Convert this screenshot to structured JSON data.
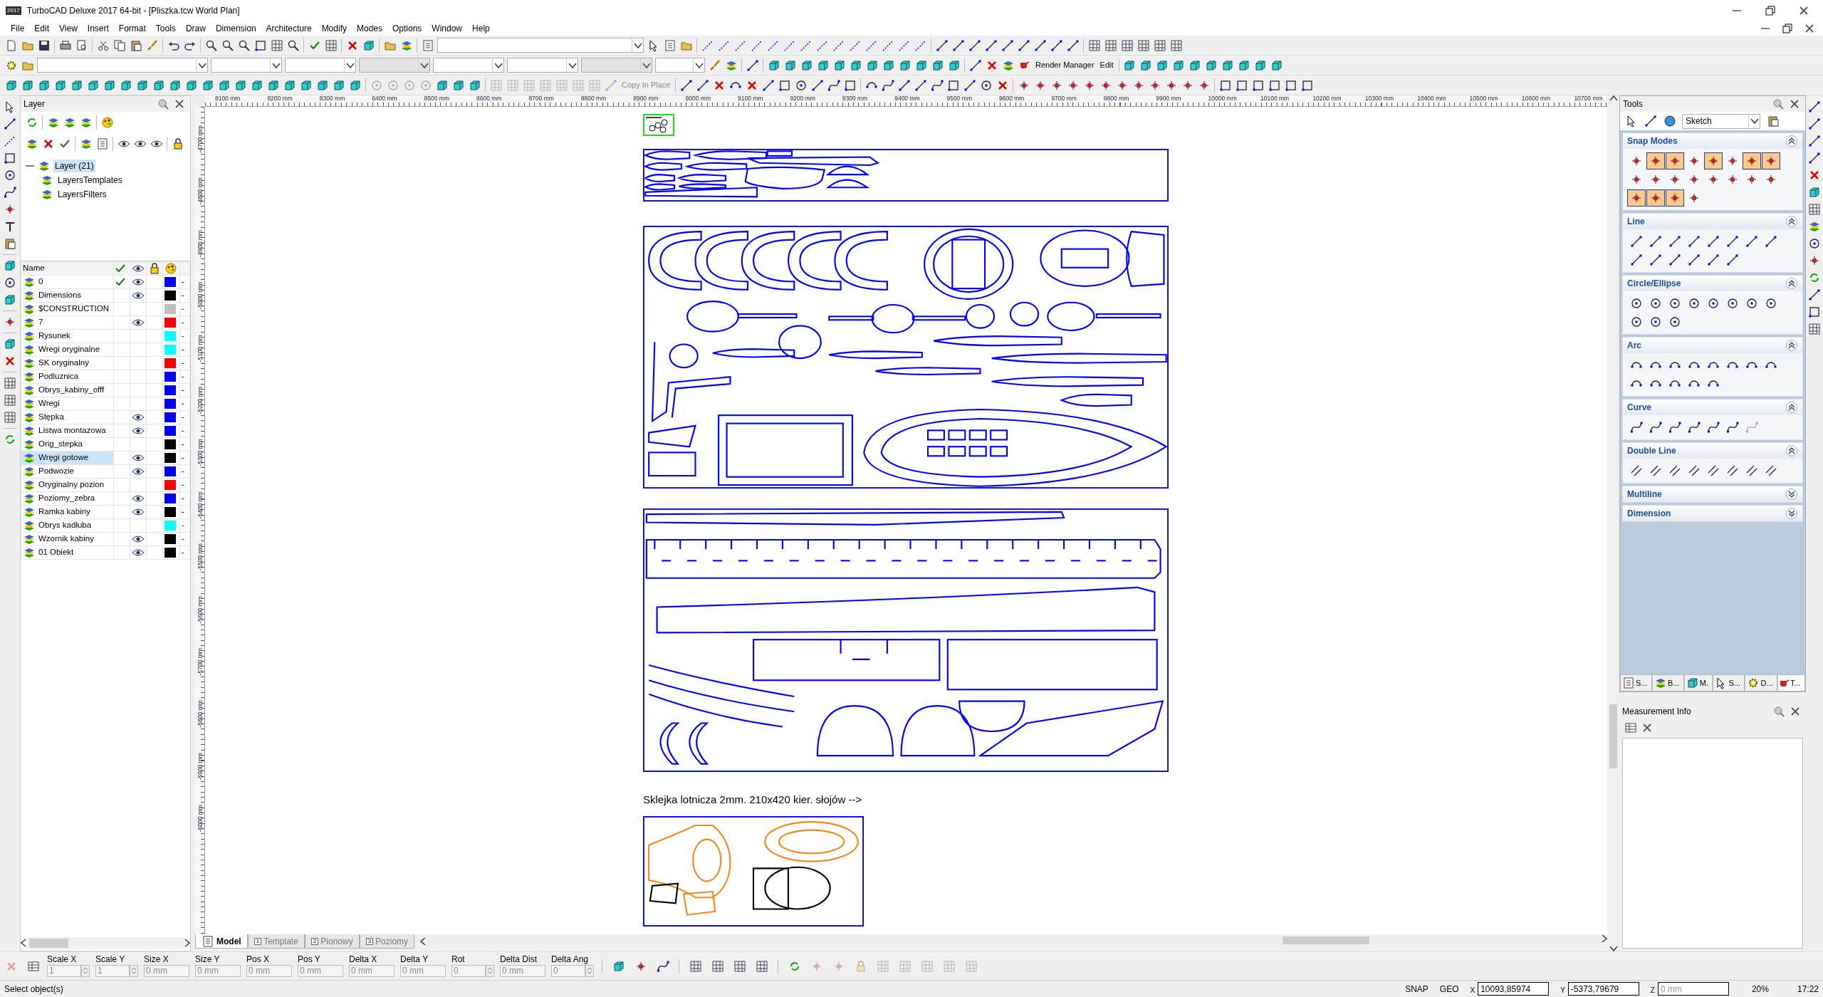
{
  "window": {
    "logo": "2017",
    "title": "TurboCAD Deluxe 2017 64-bit - [Pliszka.tcw World Plan]"
  },
  "menu": [
    "File",
    "Edit",
    "View",
    "Insert",
    "Format",
    "Tools",
    "Draw",
    "Dimension",
    "Architecture",
    "Modify",
    "Modes",
    "Options",
    "Window",
    "Help"
  ],
  "toolbars": {
    "render_manager": {
      "label": "Render Manager",
      "disabled": false
    },
    "edit": {
      "label": "Edit",
      "disabled": false
    },
    "copy_in_place": {
      "label": "Copy In Place",
      "disabled": true
    }
  },
  "rulers": {
    "top": [
      "8100 mm",
      "8200 mm",
      "8300 mm",
      "8400 mm",
      "8500 mm",
      "8600 mm",
      "8700 mm",
      "8800 mm",
      "8900 mm",
      "9000 mm",
      "9100 mm",
      "9200 mm",
      "9300 mm",
      "9400 mm",
      "9500 mm",
      "9600 mm",
      "9700 mm",
      "9800 mm",
      "9900 mm",
      "10000 mm",
      "10100 mm",
      "10200 mm",
      "10300 mm",
      "10400 mm",
      "10500 mm",
      "10600 mm",
      "10700 mm"
    ],
    "left": [
      "-4700 mm",
      "-4800 mm",
      "-4900 mm",
      "-5000 mm",
      "-5100 mm",
      "-5200 mm",
      "-5300 mm",
      "-5400 mm",
      "-5500 mm",
      "-5600 mm",
      "-5700 mm",
      "-5800 mm",
      "-5900 mm",
      "-6000 mm"
    ]
  },
  "layer_panel": {
    "title": "Layer",
    "tree": [
      {
        "label": "Layer (21)",
        "selected": true,
        "expanded": true,
        "children": [
          {
            "label": "LayersTemplates",
            "selected": false
          },
          {
            "label": "LayersFilters",
            "selected": false
          }
        ]
      }
    ],
    "name_column": "Name",
    "layers": [
      {
        "name": "0",
        "current": true,
        "visible": true,
        "color": "#0000ff",
        "line": "-",
        "selected": false
      },
      {
        "name": "Dimensions",
        "current": false,
        "visible": true,
        "color": "#000000",
        "line": "-",
        "selected": false
      },
      {
        "name": "$CONSTRUCTION",
        "current": false,
        "visible": false,
        "color": "#c0c0c0",
        "line": "-",
        "selected": false
      },
      {
        "name": "7",
        "current": false,
        "visible": true,
        "color": "#ff0000",
        "line": "-",
        "selected": false
      },
      {
        "name": "Rysunek",
        "current": false,
        "visible": false,
        "color": "#00ffff",
        "line": "-",
        "selected": false
      },
      {
        "name": "Wregi oryginalne",
        "current": false,
        "visible": false,
        "color": "#00ffff",
        "line": "-",
        "selected": false
      },
      {
        "name": "SK oryginalny",
        "current": false,
        "visible": false,
        "color": "#ff0000",
        "line": "-",
        "selected": false
      },
      {
        "name": "Podluznica",
        "current": false,
        "visible": false,
        "color": "#0000ff",
        "line": "-",
        "selected": false
      },
      {
        "name": "Obrys_kabiny_offf",
        "current": false,
        "visible": false,
        "color": "#0000ff",
        "line": "-",
        "selected": false
      },
      {
        "name": "Wregi",
        "current": false,
        "visible": false,
        "color": "#0000ff",
        "line": "-",
        "selected": false
      },
      {
        "name": "Stępka",
        "current": false,
        "visible": true,
        "color": "#0000ff",
        "line": "-",
        "selected": false
      },
      {
        "name": "Listwa montazowa",
        "current": false,
        "visible": true,
        "color": "#0000ff",
        "line": "-",
        "selected": false
      },
      {
        "name": "Orig_stepka",
        "current": false,
        "visible": false,
        "color": "#000000",
        "line": "-",
        "selected": false
      },
      {
        "name": "Wręgi gotowe",
        "current": false,
        "visible": true,
        "color": "#000000",
        "line": "-",
        "selected": true
      },
      {
        "name": "Podwozie",
        "current": false,
        "visible": true,
        "color": "#0000ff",
        "line": "-",
        "selected": false
      },
      {
        "name": "Oryginalny pozion",
        "current": false,
        "visible": false,
        "color": "#ff0000",
        "line": "-",
        "selected": false
      },
      {
        "name": "Poziomy_zebra",
        "current": false,
        "visible": true,
        "color": "#0000ff",
        "line": "-",
        "selected": false
      },
      {
        "name": "Ramka kabiny",
        "current": false,
        "visible": true,
        "color": "#000000",
        "line": "-",
        "selected": false
      },
      {
        "name": "Obrys kadłuba",
        "current": false,
        "visible": false,
        "color": "#00ffff",
        "line": "-",
        "selected": false
      },
      {
        "name": "Wzornik kabiny",
        "current": false,
        "visible": true,
        "color": "#000000",
        "line": "-",
        "selected": false
      },
      {
        "name": "01 Obiekt",
        "current": false,
        "visible": true,
        "color": "#000000",
        "line": "-",
        "selected": false
      }
    ]
  },
  "canvas": {
    "sheet_caption": "Sklejka lotnicza 2mm. 210x420 kier. słojów -->"
  },
  "sheet_tabs": [
    {
      "label": "Model",
      "selected": true
    },
    {
      "label": "Template",
      "number": "1",
      "selected": false
    },
    {
      "label": "Pionowy",
      "number": "2",
      "selected": false
    },
    {
      "label": "Poziomy",
      "number": "3",
      "selected": false
    }
  ],
  "tools_panel": {
    "title": "Tools",
    "mode": "Sketch",
    "sections": [
      {
        "kind": "snap",
        "title": "Snap Modes",
        "expanded": true,
        "items": [
          {
            "active": false
          },
          {
            "active": true
          },
          {
            "active": true
          },
          {
            "active": false
          },
          {
            "active": true
          },
          {
            "active": false
          },
          {
            "active": true
          },
          {
            "active": true
          },
          {
            "active": false
          },
          {
            "active": false
          },
          {
            "active": false
          },
          {
            "active": false
          },
          {
            "active": false
          },
          {
            "active": false
          },
          {
            "active": false
          },
          {
            "active": false
          },
          {
            "active": true
          },
          {
            "active": true
          },
          {
            "active": true
          },
          {
            "active": false
          }
        ]
      },
      {
        "kind": "tools",
        "title": "Line",
        "expanded": true,
        "items": [
          {
            "disabled": false
          },
          {
            "disabled": false
          },
          {
            "disabled": false
          },
          {
            "disabled": false
          },
          {
            "disabled": false
          },
          {
            "disabled": false
          },
          {
            "disabled": false
          },
          {
            "disabled": false
          },
          {
            "disabled": false
          },
          {
            "disabled": false
          },
          {
            "disabled": false
          },
          {
            "disabled": false
          },
          {
            "disabled": false
          },
          {
            "disabled": false
          }
        ]
      },
      {
        "kind": "tools",
        "title": "Circle/Ellipse",
        "expanded": true,
        "items": [
          {
            "disabled": false
          },
          {
            "disabled": false
          },
          {
            "disabled": false
          },
          {
            "disabled": false
          },
          {
            "disabled": false
          },
          {
            "disabled": false
          },
          {
            "disabled": false
          },
          {
            "disabled": false
          },
          {
            "disabled": false
          },
          {
            "disabled": false
          },
          {
            "disabled": false
          }
        ]
      },
      {
        "kind": "tools",
        "title": "Arc",
        "expanded": true,
        "items": [
          {
            "disabled": false
          },
          {
            "disabled": false
          },
          {
            "disabled": false
          },
          {
            "disabled": false
          },
          {
            "disabled": false
          },
          {
            "disabled": false
          },
          {
            "disabled": false
          },
          {
            "disabled": false
          },
          {
            "disabled": false
          },
          {
            "disabled": false
          },
          {
            "disabled": false
          },
          {
            "disabled": false
          },
          {
            "disabled": false
          }
        ]
      },
      {
        "kind": "tools",
        "title": "Curve",
        "expanded": true,
        "items": [
          {
            "disabled": false
          },
          {
            "disabled": false
          },
          {
            "disabled": false
          },
          {
            "disabled": false
          },
          {
            "disabled": false
          },
          {
            "disabled": false
          },
          {
            "disabled": true
          }
        ]
      },
      {
        "kind": "tools",
        "title": "Double Line",
        "expanded": true,
        "items": [
          {
            "disabled": false
          },
          {
            "disabled": false
          },
          {
            "disabled": false
          },
          {
            "disabled": false
          },
          {
            "disabled": false
          },
          {
            "disabled": false
          },
          {
            "disabled": false
          },
          {
            "disabled": false
          }
        ]
      },
      {
        "kind": "tools",
        "title": "Multiline",
        "expanded": false
      },
      {
        "kind": "tools",
        "title": "Dimension",
        "expanded": false
      }
    ],
    "tabs": [
      {
        "label": "S...",
        "selected": false
      },
      {
        "label": "B...",
        "selected": false
      },
      {
        "label": "M.",
        "selected": false
      },
      {
        "label": "S...",
        "selected": false
      },
      {
        "label": "D...",
        "selected": false
      },
      {
        "label": "T...",
        "selected": true
      }
    ]
  },
  "measurement_info": {
    "title": "Measurement Info"
  },
  "inspector": {
    "fields": [
      {
        "label": "Scale X",
        "value": "1",
        "kind": "spin",
        "disabled": true
      },
      {
        "label": "Scale Y",
        "value": "1",
        "kind": "spin",
        "disabled": true
      },
      {
        "label": "Size X",
        "value": "0 mm",
        "kind": "plain",
        "disabled": true
      },
      {
        "label": "Size Y",
        "value": "0 mm",
        "kind": "plain",
        "disabled": true
      },
      {
        "label": "Pos X",
        "value": "0 mm",
        "kind": "plain",
        "disabled": true
      },
      {
        "label": "Pos Y",
        "value": "0 mm",
        "kind": "plain",
        "disabled": true
      },
      {
        "label": "Delta X",
        "value": "0 mm",
        "kind": "plain",
        "disabled": true
      },
      {
        "label": "Delta Y",
        "value": "0 mm",
        "kind": "plain",
        "disabled": true
      },
      {
        "label": "Rot",
        "value": "0",
        "kind": "spin",
        "disabled": true
      },
      {
        "label": "Delta Dist",
        "value": "0 mm",
        "kind": "plain",
        "disabled": true
      },
      {
        "label": "Delta Ang",
        "value": "0",
        "kind": "spin",
        "disabled": true
      }
    ]
  },
  "status_bar": {
    "message": "Select object(s)",
    "snap": "SNAP",
    "geo": "GEO",
    "coords": [
      {
        "axis": "X",
        "value": "10093,85974"
      },
      {
        "axis": "Y",
        "value": "-5373,79679"
      },
      {
        "axis": "Z",
        "placeholder": "0 mm"
      }
    ],
    "zoom": "20%",
    "time": "17:22"
  }
}
